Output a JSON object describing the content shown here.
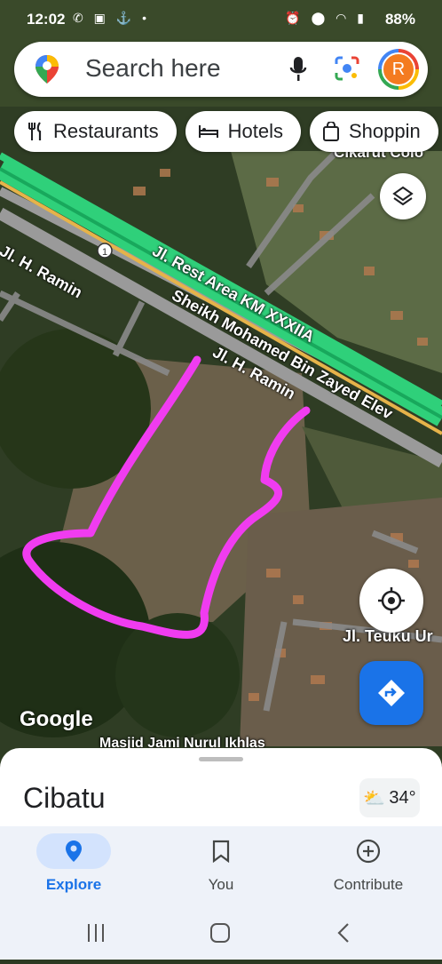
{
  "status_bar": {
    "time": "12:02",
    "battery": "88%",
    "left_icons": [
      "whatsapp-icon",
      "gallery-icon",
      "usb-icon",
      "dot-icon"
    ],
    "right_icons": [
      "alarm-icon",
      "location-icon",
      "wifi-icon",
      "volte-icon",
      "signal-icon"
    ]
  },
  "search": {
    "placeholder": "Search here",
    "avatar_letter": "R"
  },
  "chips": [
    {
      "label": "Restaurants",
      "icon": "fork-knife-icon"
    },
    {
      "label": "Hotels",
      "icon": "bed-icon"
    },
    {
      "label": "Shoppin",
      "icon": "shopping-bag-icon"
    }
  ],
  "map": {
    "attribution": "Google",
    "labels": {
      "top_right": "\"Cikarut Colo",
      "road1": "Jl. H. Ramin",
      "road2": "Jl. Rest Area KM XXXIIA",
      "road3": "Sheikh Mohamed Bin Zayed Elev",
      "road4": "Jl. H. Ramin",
      "road5": "Jl. Teuku Ur",
      "poi": "Masjid Jami Nurul Ikhlas",
      "shield": "1"
    }
  },
  "sheet": {
    "place": "Cibatu",
    "temperature": "34°"
  },
  "nav": [
    {
      "label": "Explore",
      "icon": "location-pin-icon",
      "active": true
    },
    {
      "label": "You",
      "icon": "bookmark-icon",
      "active": false
    },
    {
      "label": "Contribute",
      "icon": "add-circle-icon",
      "active": false
    }
  ],
  "colors": {
    "accent": "#1a73e8",
    "highlight_stroke": "#f03cf0",
    "road_green": "#2fd07a"
  }
}
